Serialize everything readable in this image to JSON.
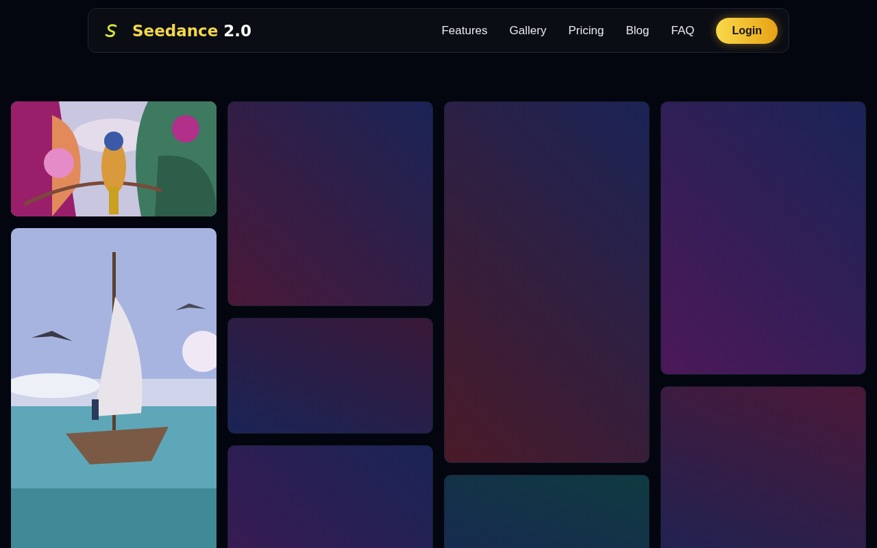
{
  "nav": {
    "brand": "Seedance",
    "version": "2.0",
    "links": [
      {
        "label": "Features"
      },
      {
        "label": "Gallery"
      },
      {
        "label": "Pricing"
      },
      {
        "label": "Blog"
      },
      {
        "label": "FAQ"
      }
    ],
    "login": "Login"
  },
  "gallery": [
    {
      "items": [
        {
          "kind": "picture"
        },
        {
          "kind": "picture"
        }
      ]
    },
    {
      "items": [
        {
          "kind": "placeholder",
          "color": "#4a1838"
        },
        {
          "kind": "placeholder",
          "color": "#3a1838"
        },
        {
          "kind": "placeholder",
          "color": "#3a1a52"
        }
      ]
    },
    {
      "items": [
        {
          "kind": "placeholder",
          "color": "#4a1a28"
        },
        {
          "kind": "placeholder",
          "color": "#0f3a40"
        }
      ]
    },
    {
      "items": [
        {
          "kind": "placeholder",
          "color": "#4c1858"
        },
        {
          "kind": "placeholder",
          "color": "#4a1838"
        }
      ]
    }
  ]
}
